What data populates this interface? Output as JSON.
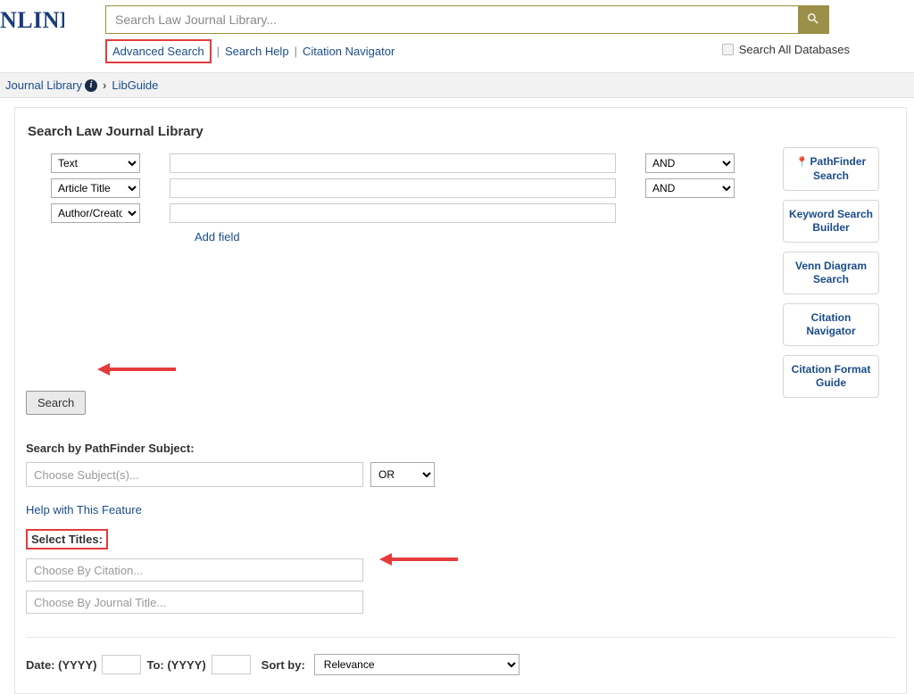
{
  "logo_fragment": "NLINE",
  "search": {
    "placeholder": "Search Law Journal Library...",
    "advanced_label": "Advanced Search",
    "help_label": "Search Help",
    "citation_nav_label": "Citation Navigator",
    "search_all_db_label": "Search All Databases"
  },
  "breadcrumb": {
    "library": "Journal Library",
    "libguide": "LibGuide"
  },
  "panel": {
    "title": "Search Law Journal Library",
    "field_options": [
      "Text",
      "Article Title",
      "Author/Creator"
    ],
    "bool_options": [
      "AND"
    ],
    "add_field": "Add field",
    "search_btn": "Search",
    "side": {
      "pathfinder": "PathFinder Search",
      "keyword": "Keyword Search Builder",
      "venn": "Venn Diagram Search",
      "citation_nav": "Citation Navigator",
      "citation_fmt": "Citation Format Guide"
    },
    "pathfinder_label": "Search by PathFinder Subject:",
    "subject_placeholder": "Choose Subject(s)...",
    "or_option": "OR",
    "help_feature": "Help with This Feature",
    "select_titles": "Select Titles:",
    "by_citation_ph": "Choose By Citation...",
    "by_journal_ph": "Choose By Journal Title...",
    "date_label": "Date: (YYYY)",
    "to_label": "To: (YYYY)",
    "sort_label": "Sort by:",
    "sort_option": "Relevance"
  }
}
